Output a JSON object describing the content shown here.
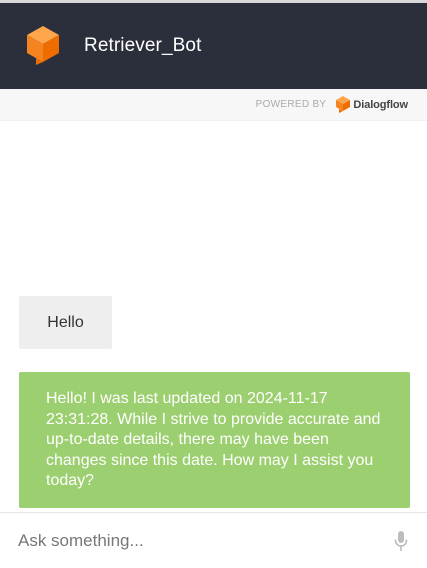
{
  "header": {
    "bot_name": "Retriever_Bot",
    "logo_icon": "dialogflow-cube-icon",
    "background": "#2b2f3c"
  },
  "powered_by": {
    "label": "POWERED BY",
    "brand": "Dialogflow",
    "logo_icon": "dialogflow-logo-icon"
  },
  "messages": [
    {
      "sender": "user",
      "text": "Hello",
      "background": "#eeeeee"
    },
    {
      "sender": "bot",
      "text": "Hello! I was last updated on 2024-11-17 23:31:28. While I strive to provide accurate and up-to-date details, there may have been changes since this date. How may I assist you today?",
      "background": "#9ccf70"
    }
  ],
  "input": {
    "placeholder": "Ask something...",
    "value": "",
    "mic_icon": "microphone-icon"
  },
  "colors": {
    "accent_orange": "#f5831f",
    "bot_bubble": "#9ccf70"
  }
}
